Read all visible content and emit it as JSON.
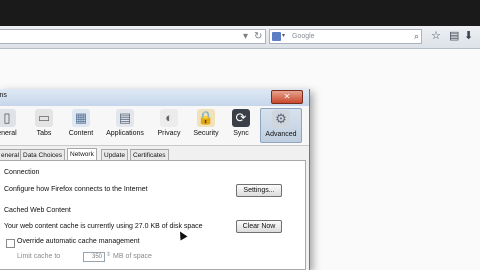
{
  "browser": {
    "search_placeholder": "Google",
    "icons": [
      "dropdown-icon",
      "reload-icon",
      "search-engine-icon",
      "search-go-icon",
      "bookmark-star-icon",
      "bookmarks-menu-icon",
      "download-icon",
      "home-icon"
    ]
  },
  "dialog": {
    "title": "ions",
    "close_label": "✕",
    "panes": [
      {
        "label": "eneral",
        "icon": "general-icon"
      },
      {
        "label": "Tabs",
        "icon": "tabs-icon"
      },
      {
        "label": "Content",
        "icon": "content-icon"
      },
      {
        "label": "Applications",
        "icon": "applications-icon"
      },
      {
        "label": "Privacy",
        "icon": "privacy-icon"
      },
      {
        "label": "Security",
        "icon": "security-icon"
      },
      {
        "label": "Sync",
        "icon": "sync-icon"
      },
      {
        "label": "Advanced",
        "icon": "advanced-icon",
        "active": true
      }
    ],
    "tabs": [
      {
        "label": "eneral"
      },
      {
        "label": "Data Choices"
      },
      {
        "label": "Network",
        "active": true
      },
      {
        "label": "Update"
      },
      {
        "label": "Certificates"
      }
    ],
    "connection": {
      "heading": "Connection",
      "description": "Configure how Firefox connects to the Internet",
      "settings_label": "Settings..."
    },
    "cache": {
      "heading": "Cached Web Content",
      "usage_text": "Your web content cache is currently using 27.0 KB of disk space",
      "clear_label": "Clear Now",
      "override_label": "Override automatic cache management",
      "limit_label": "Limit cache to",
      "limit_value": "350",
      "limit_unit": "MB of space"
    }
  }
}
